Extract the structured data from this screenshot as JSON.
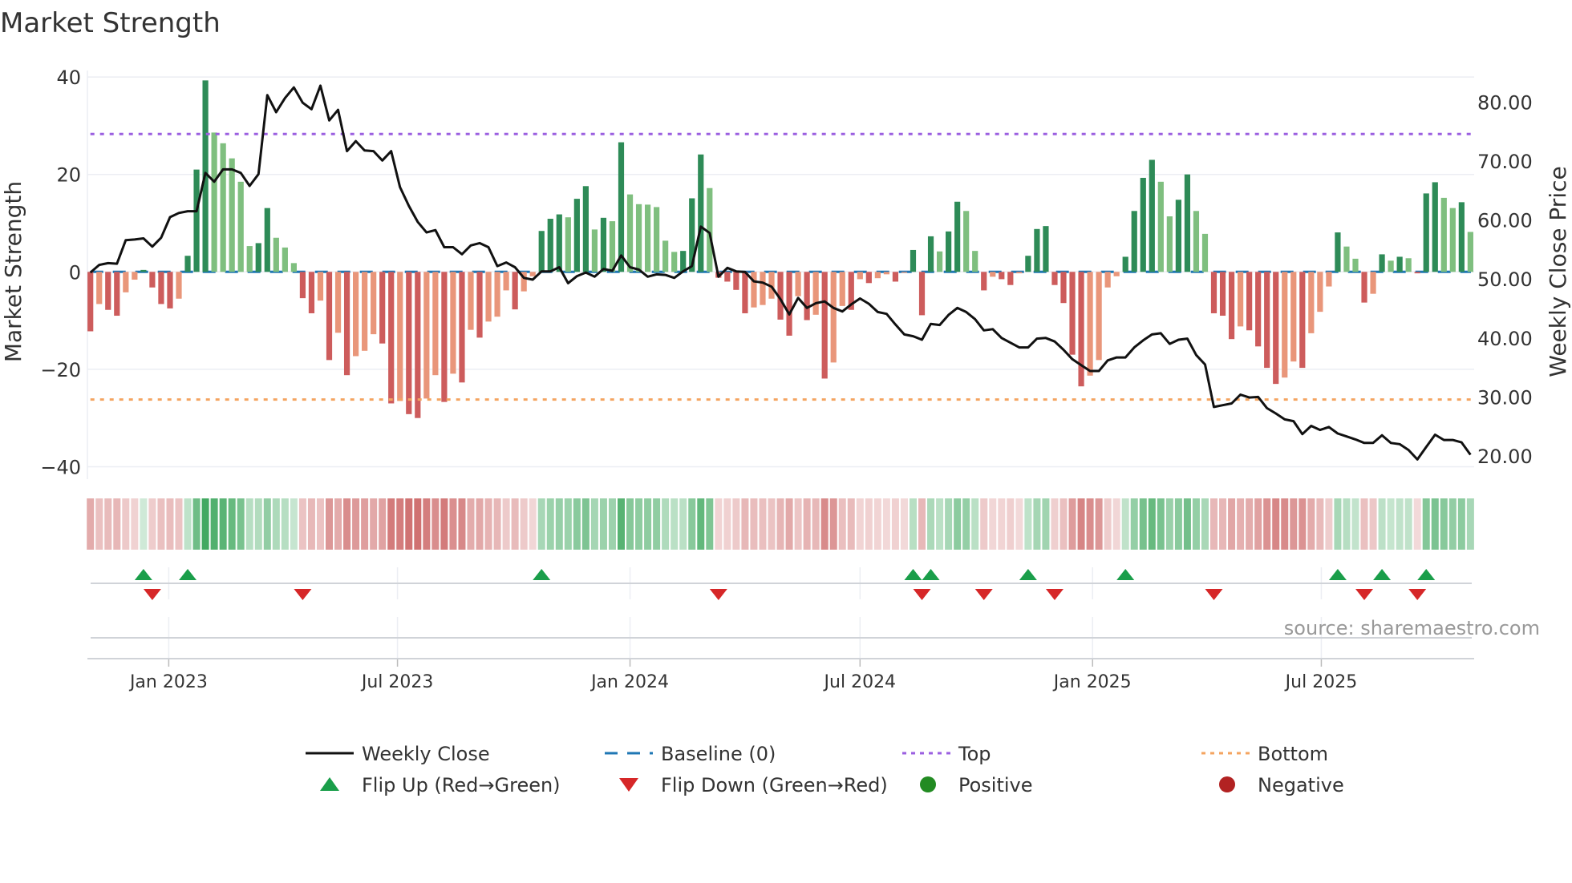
{
  "chart_data": {
    "type": "bar",
    "title": "Market Strength",
    "ylabel": "Market Strength",
    "y2label": "Weekly Close Price",
    "source": "source: sharemaestro.com",
    "x_start": "2022-10-31",
    "x_frequency": "weekly",
    "ylim": [
      -40,
      40
    ],
    "yticks": [
      "40",
      "20",
      "0",
      "−20",
      "−40"
    ],
    "ytick_values": [
      40,
      20,
      0,
      -20,
      -40
    ],
    "y2lim": [
      20,
      80
    ],
    "y2ticks": [
      "80.00",
      "70.00",
      "60.00",
      "50.00",
      "40.00",
      "30.00",
      "20.00"
    ],
    "y2tick_values": [
      80,
      70,
      60,
      50,
      40,
      30,
      20
    ],
    "xticks": [
      {
        "label": "Jan 2023",
        "date": "2023-01-01"
      },
      {
        "label": "Jul 2023",
        "date": "2023-07-01"
      },
      {
        "label": "Jan 2024",
        "date": "2024-01-01"
      },
      {
        "label": "Jul 2024",
        "date": "2024-07-01"
      },
      {
        "label": "Jan 2025",
        "date": "2025-01-01"
      },
      {
        "label": "Jul 2025",
        "date": "2025-07-01"
      }
    ],
    "top_level": 28.3,
    "bottom_level": -26.2,
    "baseline": 0,
    "grid": true,
    "legend_position": "bottom",
    "series": [
      {
        "name": "Market Strength",
        "values": [
          -12.2,
          -6.6,
          -7.8,
          -9.0,
          -4.2,
          -1.6,
          0.4,
          -3.2,
          -6.6,
          -7.5,
          -5.5,
          3.3,
          21.0,
          39.3,
          28.6,
          26.4,
          23.3,
          18.5,
          5.3,
          5.9,
          13.1,
          7.0,
          5.0,
          1.8,
          -5.4,
          -8.5,
          -5.9,
          -18.1,
          -12.5,
          -21.2,
          -17.3,
          -16.2,
          -12.8,
          -14.7,
          -27.0,
          -26.5,
          -29.2,
          -30.0,
          -26.0,
          -21.2,
          -26.7,
          -20.9,
          -22.7,
          -11.9,
          -13.5,
          -10.2,
          -9.2,
          -3.8,
          -7.7,
          -4.0,
          -0.9,
          8.4,
          10.9,
          11.8,
          11.2,
          15.0,
          17.6,
          8.7,
          11.1,
          10.4,
          26.6,
          15.9,
          13.9,
          13.8,
          13.3,
          6.4,
          4.1,
          4.3,
          15.1,
          24.1,
          17.2,
          -1.2,
          -2.0,
          -3.7,
          -8.5,
          -7.3,
          -6.8,
          -5.5,
          -9.8,
          -13.1,
          -5.0,
          -9.9,
          -8.8,
          -21.9,
          -18.6,
          -7.0,
          -7.8,
          -1.5,
          -2.3,
          -1.3,
          -0.5,
          -2.0,
          -0.2,
          4.5,
          -8.9,
          7.3,
          4.2,
          8.3,
          14.4,
          12.5,
          4.3,
          -3.8,
          -1.0,
          -1.5,
          -2.7,
          -0.3,
          3.3,
          8.8,
          9.4,
          -2.7,
          -6.4,
          -17.0,
          -23.5,
          -21.3,
          -18.1,
          -3.2,
          -0.9,
          3.1,
          12.5,
          19.3,
          23.0,
          18.5,
          11.4,
          14.8,
          20.0,
          12.5,
          7.8,
          -8.5,
          -9.0,
          -13.8,
          -11.2,
          -12.0,
          -15.3,
          -19.7,
          -23.0,
          -21.7,
          -18.4,
          -19.7,
          -12.6,
          -8.2,
          -3.0,
          8.1,
          5.2,
          2.7,
          -6.3,
          -4.5,
          3.6,
          2.3,
          3.1,
          2.8,
          -0.3,
          16.1,
          18.4,
          15.2,
          13.1,
          14.3,
          8.2
        ]
      },
      {
        "name": "Weekly Close",
        "axis": "right",
        "values": [
          51.1,
          52.4,
          52.7,
          52.6,
          56.6,
          56.7,
          56.9,
          55.5,
          57.0,
          60.5,
          61.2,
          61.5,
          61.5,
          68.0,
          66.5,
          68.6,
          68.6,
          68.0,
          65.8,
          67.8,
          81.2,
          78.3,
          80.7,
          82.5,
          79.9,
          78.8,
          82.8,
          76.9,
          78.7,
          71.7,
          73.4,
          71.8,
          71.7,
          70.1,
          71.7,
          65.6,
          62.4,
          59.7,
          57.9,
          58.3,
          55.4,
          55.4,
          54.2,
          55.7,
          56.1,
          55.4,
          52.2,
          52.8,
          52.0,
          50.2,
          49.9,
          51.3,
          51.3,
          52.0,
          49.3,
          50.5,
          51.1,
          50.4,
          51.7,
          51.4,
          54.0,
          52.0,
          51.6,
          50.4,
          50.8,
          50.7,
          50.2,
          51.3,
          52.2,
          58.9,
          57.8,
          50.4,
          51.9,
          51.3,
          51.2,
          49.6,
          49.4,
          48.7,
          46.6,
          44.0,
          46.8,
          45.1,
          45.9,
          46.2,
          45.1,
          44.5,
          45.7,
          46.7,
          45.8,
          44.4,
          44.1,
          42.3,
          40.6,
          40.3,
          39.7,
          42.4,
          42.2,
          43.9,
          45.1,
          44.4,
          43.2,
          41.3,
          41.5,
          40.0,
          39.2,
          38.4,
          38.4,
          39.9,
          40.0,
          39.4,
          38.0,
          36.4,
          35.4,
          34.4,
          34.4,
          36.2,
          36.7,
          36.7,
          38.4,
          39.6,
          40.6,
          40.8,
          39.0,
          39.7,
          39.9,
          37.1,
          35.5,
          28.3,
          28.6,
          28.9,
          30.4,
          29.9,
          30.0,
          28.1,
          27.2,
          26.2,
          25.9,
          23.7,
          25.1,
          24.4,
          24.9,
          23.8,
          23.3,
          22.8,
          22.2,
          22.2,
          23.5,
          22.2,
          22.0,
          21.0,
          19.4,
          21.5,
          23.6,
          22.7,
          22.7,
          22.3,
          20.2
        ]
      }
    ],
    "legend": [
      {
        "label": "Weekly Close",
        "kind": "line"
      },
      {
        "label": "Baseline (0)",
        "kind": "dash"
      },
      {
        "label": "Top",
        "kind": "dot-top"
      },
      {
        "label": "Bottom",
        "kind": "dot-bottom"
      },
      {
        "label": "Flip Up (Red→Green)",
        "kind": "tri-up"
      },
      {
        "label": "Flip Down (Green→Red)",
        "kind": "tri-down"
      },
      {
        "label": "Positive",
        "kind": "circle-pos"
      },
      {
        "label": "Negative",
        "kind": "circle-neg"
      }
    ],
    "colors": {
      "pos_strong": "#2e8b57",
      "pos_weak": "#7fbf7f",
      "neg_strong": "#cd5c5c",
      "neg_weak": "#e9967a",
      "close": "#111111",
      "baseline": "#1f77b4",
      "top": "#9b5fe0",
      "bottom": "#f4a460",
      "flip_up": "#1a9e4a",
      "flip_down": "#d62728",
      "positive": "#228b22",
      "negative": "#b22222"
    }
  }
}
